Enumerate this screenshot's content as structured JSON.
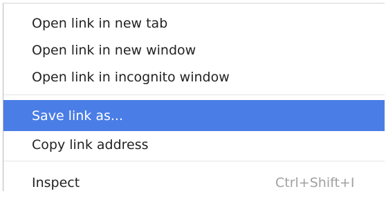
{
  "theme": {
    "highlight_color": "#4a7de6",
    "text_color": "#222222",
    "shortcut_color": "#a0a0a0",
    "separator_color": "#e4e4e4"
  },
  "context_menu": {
    "items": [
      {
        "label": "Open link in new tab",
        "shortcut": ""
      },
      {
        "label": "Open link in new window",
        "shortcut": ""
      },
      {
        "label": "Open link in incognito window",
        "shortcut": ""
      },
      {
        "label": "Save link as...",
        "shortcut": "",
        "highlighted": true
      },
      {
        "label": "Copy link address",
        "shortcut": ""
      },
      {
        "label": "Inspect",
        "shortcut": "Ctrl+Shift+I"
      }
    ]
  }
}
